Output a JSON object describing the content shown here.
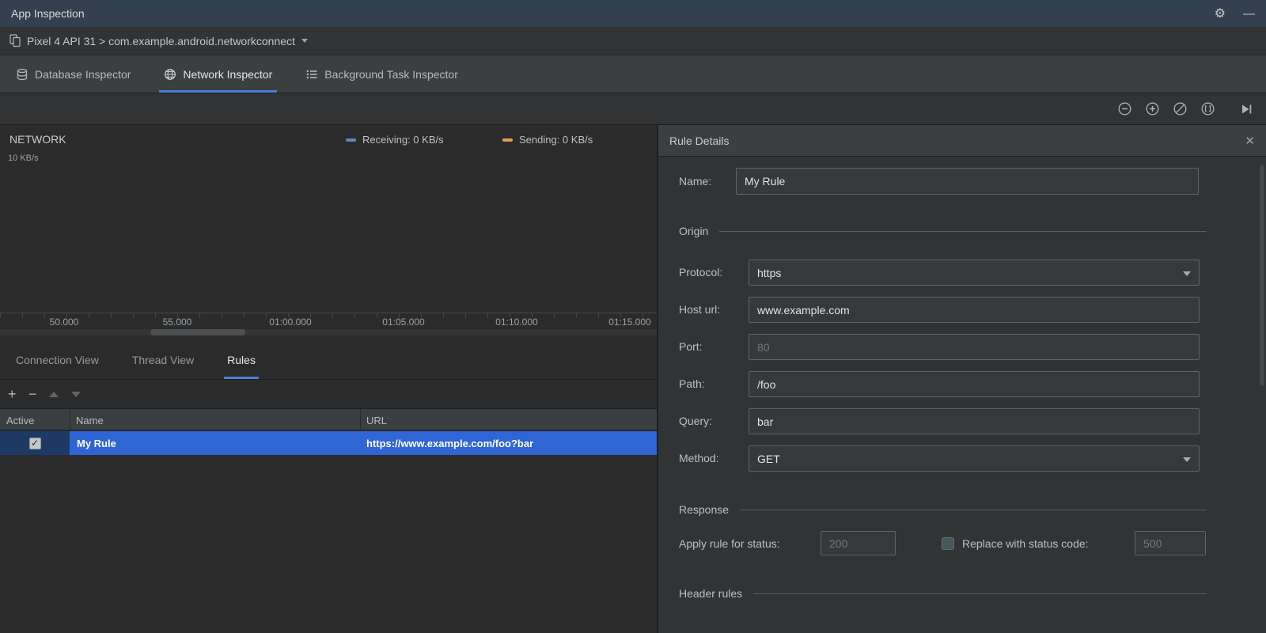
{
  "titlebar": {
    "title": "App Inspection"
  },
  "device_bar": {
    "label": "Pixel 4 API 31 > com.example.android.networkconnect"
  },
  "inspector_tabs": {
    "database": "Database Inspector",
    "network": "Network Inspector",
    "background": "Background Task Inspector"
  },
  "timeline": {
    "title": "NETWORK",
    "y_max_label": "10 KB/s",
    "legend_receiving": "Receiving: 0 KB/s",
    "legend_sending": "Sending: 0 KB/s",
    "receiving_color": "#6285c6",
    "sending_color": "#dfa04c",
    "ticks": [
      "50.000",
      "55.000",
      "01:00.000",
      "01:05.000",
      "01:10.000",
      "01:15.000"
    ]
  },
  "view_tabs": {
    "connection": "Connection View",
    "thread": "Thread View",
    "rules": "Rules"
  },
  "rules_table": {
    "columns": {
      "active": "Active",
      "name": "Name",
      "url": "URL"
    },
    "row": {
      "active": true,
      "name": "My Rule",
      "url": "https://www.example.com/foo?bar"
    },
    "selection_color": "#2f65d4"
  },
  "rule_details": {
    "title": "Rule Details",
    "name_label": "Name:",
    "name_value": "My Rule",
    "sections": {
      "origin": "Origin",
      "response": "Response",
      "header_rules": "Header rules"
    },
    "origin": {
      "protocol_label": "Protocol:",
      "protocol_value": "https",
      "host_label": "Host url:",
      "host_value": "www.example.com",
      "port_label": "Port:",
      "port_placeholder": "80",
      "path_label": "Path:",
      "path_value": "/foo",
      "query_label": "Query:",
      "query_value": "bar",
      "method_label": "Method:",
      "method_value": "GET"
    },
    "response": {
      "apply_label": "Apply rule for status:",
      "apply_placeholder": "200",
      "replace_label": "Replace with status code:",
      "replace_placeholder": "500"
    }
  }
}
